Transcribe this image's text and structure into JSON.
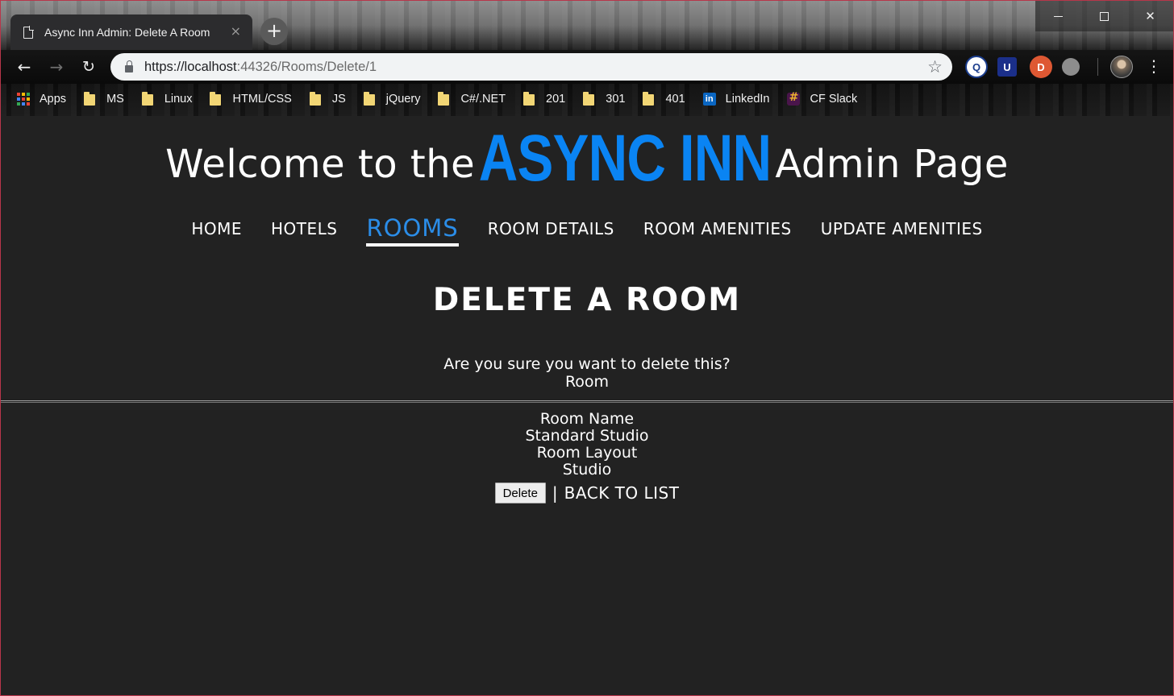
{
  "browser": {
    "tab_title": "Async Inn Admin: Delete A Room",
    "tab_close": "×",
    "new_tab": "+",
    "url_host": "https://localhost",
    "url_rest": ":44326/Rooms/Delete/1",
    "window_controls": {
      "minimize": "",
      "maximize": "",
      "close": "✕"
    },
    "nav": {
      "back": "←",
      "forward": "→",
      "reload": "↻"
    },
    "star": "☆",
    "menu": "⋮",
    "bookmarks": [
      {
        "label": "Apps",
        "icon": "apps-icon"
      },
      {
        "label": "MS",
        "icon": "folder-icon"
      },
      {
        "label": "Linux",
        "icon": "folder-icon"
      },
      {
        "label": "HTML/CSS",
        "icon": "folder-icon"
      },
      {
        "label": "JS",
        "icon": "folder-icon"
      },
      {
        "label": "jQuery",
        "icon": "folder-icon"
      },
      {
        "label": "C#/.NET",
        "icon": "folder-icon"
      },
      {
        "label": "201",
        "icon": "folder-icon"
      },
      {
        "label": "301",
        "icon": "folder-icon"
      },
      {
        "label": "401",
        "icon": "folder-icon"
      },
      {
        "label": "LinkedIn",
        "icon": "linkedin-icon"
      },
      {
        "label": "CF Slack",
        "icon": "slack-icon"
      }
    ]
  },
  "header": {
    "prefix": "Welcome to the",
    "brand": "ASYNC INN",
    "suffix": "Admin Page"
  },
  "nav": {
    "items": [
      {
        "label": "HOME",
        "active": false
      },
      {
        "label": "HOTELS",
        "active": false
      },
      {
        "label": "ROOMS",
        "active": true
      },
      {
        "label": "ROOM DETAILS",
        "active": false
      },
      {
        "label": "ROOM AMENITIES",
        "active": false
      },
      {
        "label": "UPDATE AMENITIES",
        "active": false
      }
    ]
  },
  "main": {
    "title": "DELETE A ROOM",
    "confirm_question": "Are you sure you want to delete this?",
    "record_type": "Room",
    "details": [
      {
        "label": "Room Name",
        "value": "Standard Studio"
      },
      {
        "label": "Room Layout",
        "value": "Studio"
      }
    ],
    "delete_button": "Delete",
    "separator": "|",
    "back_link": "BACK TO LIST"
  },
  "colors": {
    "page_background": "#222222",
    "brand_blue": "#0a84f3",
    "active_nav": "#2b8de8",
    "text": "#ffffff"
  }
}
